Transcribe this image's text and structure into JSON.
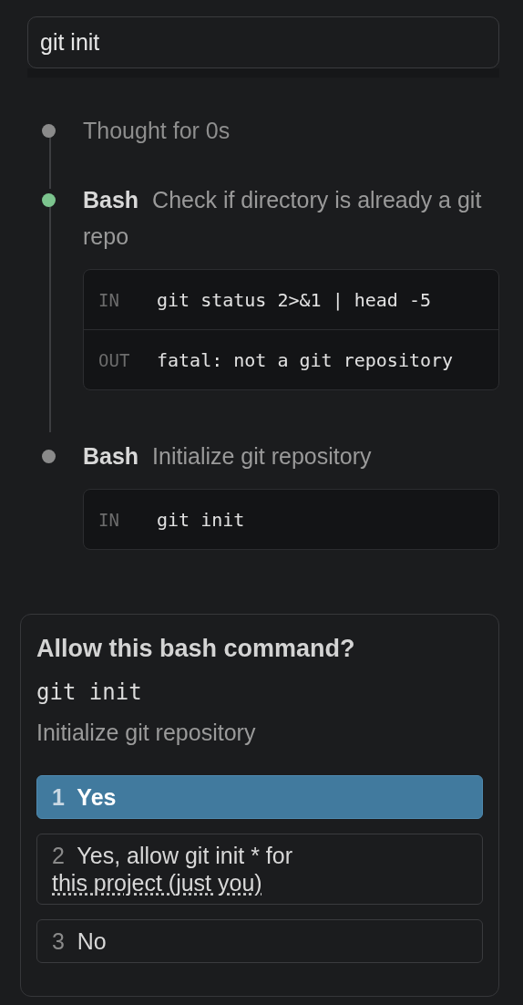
{
  "prompt_field": {
    "value": "git init"
  },
  "steps": [
    {
      "kind": "thought",
      "color": "#8a8a8a",
      "text": "Thought for 0s"
    },
    {
      "kind": "tool",
      "color": "#7cc48e",
      "tool": "Bash",
      "description": "Check if directory is already a git repo",
      "io": [
        {
          "label": "IN",
          "text": "git status 2>&1 | head -5"
        },
        {
          "label": "OUT",
          "text": "fatal: not a git repository"
        }
      ]
    },
    {
      "kind": "tool",
      "color": "#8a8a8a",
      "tool": "Bash",
      "description": "Initialize git repository",
      "io": [
        {
          "label": "IN",
          "text": "git init"
        }
      ]
    }
  ],
  "permission": {
    "title": "Allow this bash command?",
    "command": "git init",
    "description": "Initialize git repository",
    "options": [
      {
        "number": "1",
        "label": "Yes",
        "selected": true
      },
      {
        "number": "2",
        "label": "Yes, allow git init * for",
        "link": "this project (just you)",
        "selected": false
      },
      {
        "number": "3",
        "label": "No",
        "selected": false
      }
    ]
  }
}
